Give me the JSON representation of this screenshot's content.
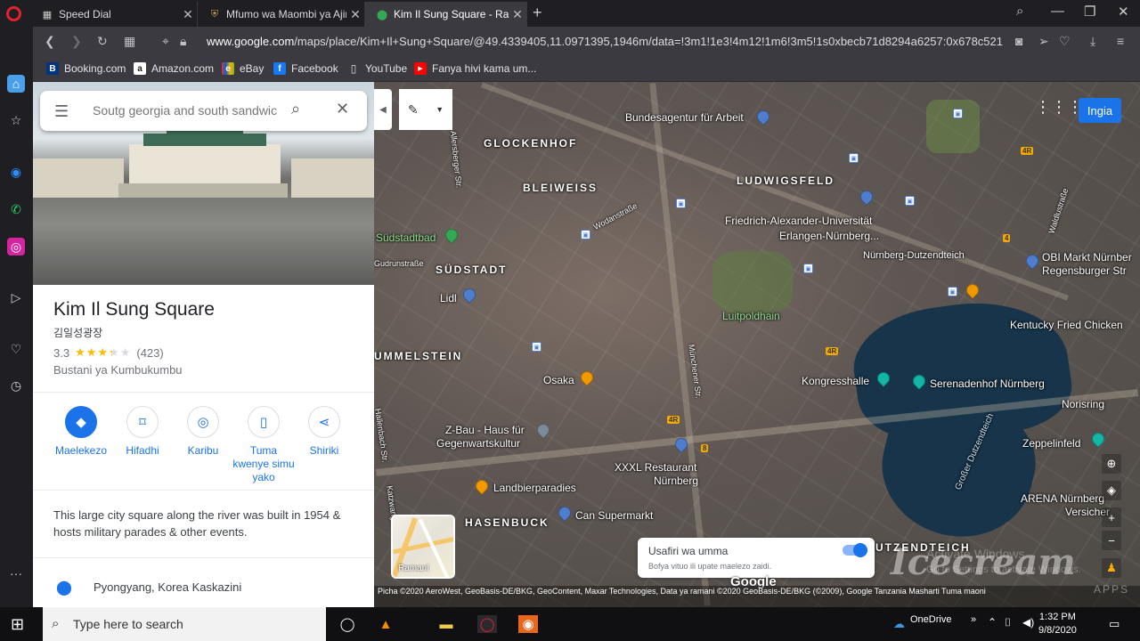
{
  "browser": {
    "tabs": [
      {
        "title": "Speed Dial",
        "icon": "grid-icon",
        "active": false
      },
      {
        "title": "Mfumo wa Maombi ya Ajir",
        "icon": "crest-icon",
        "active": false
      },
      {
        "title": "Kim Il Sung Square - Ramar",
        "icon": "maps-pin-icon",
        "active": true
      }
    ],
    "url_prefix": "www.google.com",
    "url_rest": "/maps/place/Kim+Il+Sung+Square/@49.4339405,11.0971395,1946m/data=!3m1!1e3!4m12!1m6!3m5!1s0xbecb71d8294a6257:0x678c521",
    "bookmarks": [
      {
        "label": "Booking.com",
        "icon_letter": "B",
        "color": "#003580"
      },
      {
        "label": "Amazon.com",
        "icon_letter": "a",
        "color": "#222222"
      },
      {
        "label": "eBay",
        "icon_letter": "e",
        "color": "#e53238"
      },
      {
        "label": "Facebook",
        "icon_letter": "f",
        "color": "#1877f2"
      },
      {
        "label": "YouTube",
        "icon_letter": "▯",
        "color": "#555555"
      },
      {
        "label": "Fanya hivi kama um...",
        "icon_letter": "▶",
        "color": "#ff0000"
      }
    ]
  },
  "panel": {
    "search_placeholder": "Soutg georgia and south sandwic",
    "place_name": "Kim Il Sung Square",
    "place_native": "김일성광장",
    "rating": "3.3",
    "rating_stars": 3.3,
    "review_count": "(423)",
    "category": "Bustani ya Kumbukumbu",
    "actions": [
      {
        "label": "Maelekezo",
        "icon": "directions-icon",
        "primary": true
      },
      {
        "label": "Hifadhi",
        "icon": "bookmark-icon",
        "primary": false
      },
      {
        "label": "Karibu",
        "icon": "nearby-icon",
        "primary": false
      },
      {
        "label": "Tuma kwenye simu yako",
        "icon": "send-to-phone-icon",
        "primary": false
      },
      {
        "label": "Shiriki",
        "icon": "share-icon",
        "primary": false
      }
    ],
    "description": "This large city square along the river was built in 1954 & hosts military parades & other events.",
    "address": "Pyongyang, Korea Kaskazini"
  },
  "map": {
    "signin_label": "Ingia",
    "minimap_label": "Ramani",
    "transit_title": "Usafiri wa umma",
    "transit_sub": "Bofya vituo ili upate maelezo zaidi.",
    "google_logo": "Google",
    "attribution": "Picha ©2020 AeroWest, GeoBasis-DE/BKG, GeoContent, Maxar Technologies, Data ya ramani ©2020 GeoBasis-DE/BKG (©2009), Google   Tanzania   Masharti   Tuma maoni",
    "labels": {
      "bundesagentur": "Bundesagentur für Arbeit",
      "glockenhof": "GLOCKENHOF",
      "bleiweiss": "BLEIWEISS",
      "ludwigsfeld": "LUDWIGSFELD",
      "fau": "Friedrich-Alexander-Universität",
      "fau2": "Erlangen-Nürnberg...",
      "suedstadtbad": "Südstadtbad",
      "gudrunstr": "Gudrunstraße",
      "suedstadt": "SÜDSTADT",
      "lidl": "Lidl",
      "nbg_dutzend": "Nürnberg-Dutzendteich",
      "obi": "OBI Markt Nürnber",
      "obi2": "Regensburger Str",
      "luitpoldhain": "Luitpoldhain",
      "kfc": "Kentucky Fried Chicken",
      "mmelstein": "UMMELSTEIN",
      "osaka": "Osaka",
      "kongress": "Kongresshalle",
      "serenade": "Serenadenhof Nürnberg",
      "norisring": "Norisring",
      "zbau": "Z-Bau - Haus für",
      "zbau2": "Gegenwartskultur",
      "xxxl": "XXXL Restaurant",
      "xxxl2": "Nürnberg",
      "zeppelin": "Zeppelinfeld",
      "landbier": "Landbierparadies",
      "hasenbuck": "HASENBUCK",
      "cansuper": "Can Supermarkt",
      "arena": "ARENA Nürnberg",
      "arena2": "Versicher",
      "dutzendteich": "UTZENDTEICH",
      "grosser": "Großer Dutzendteich",
      "wodan": "Wodanstraße",
      "allersberger": "Allersberger Str.",
      "muenchener": "Münchener Str.",
      "waldlust": "Waldlustraße",
      "katzwanger": "Katzwanger Str.",
      "hallerberther": "Hallenbach Str."
    },
    "road_4r_a": "4R",
    "road_4r_b": "4R",
    "road_4r_c": "4R",
    "road_4": "4",
    "road_8": "8"
  },
  "taskbar": {
    "search_placeholder": "Type here to search",
    "onedrive": "OneDrive",
    "time": "1:32 PM",
    "date": "9/8/2020"
  },
  "overlay": {
    "activate_title": "Activate Windows",
    "activate_sub": "Go to Settings to activate Windows.",
    "watermark": "Icecream",
    "watermark_sub": "APPS"
  }
}
